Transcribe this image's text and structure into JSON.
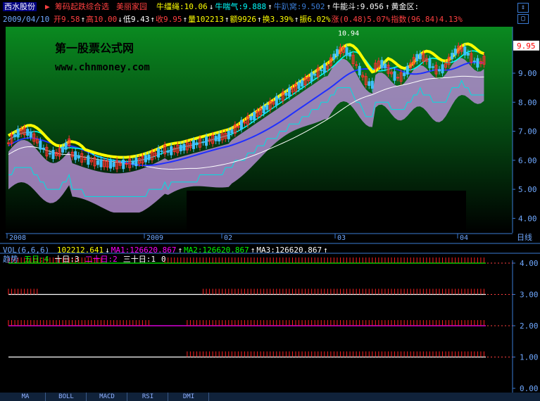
{
  "header": {
    "stock_name": "西水股份",
    "indicator_name": "筹码起跌综合选",
    "theme": "美丽家园",
    "labels": [
      {
        "text": "牛缰绳:10.06",
        "color": "#ffff00",
        "arrow": "↓"
      },
      {
        "text": "牛喘气:9.888",
        "color": "#00ffff",
        "arrow": "↑"
      },
      {
        "text": "牛趴窝:9.502",
        "color": "#3a7bd5",
        "arrow": "↑"
      },
      {
        "text": "牛能斗:9.056",
        "color": "#ffffff",
        "arrow": "↑"
      },
      {
        "text": "黄金区:",
        "color": "#ffffff",
        "arrow": ""
      }
    ],
    "row2": {
      "date": "2009/04/10",
      "open": "开9.58",
      "high": "高10.00",
      "low": "低9.43",
      "close": "收9.95",
      "volume": "量102213",
      "amount": "额9926",
      "turnover": "换3.39%",
      "amplitude": "振6.02%",
      "change": "涨(0.48)5.07%",
      "index": "指数(96.84)4.13%"
    }
  },
  "chart_data": {
    "type": "candlestick",
    "watermark_line1": "第一股票公式网",
    "watermark_line2": "www.chnmoney.com",
    "price_tag": "9.95",
    "peak_label": "10.94",
    "y_ticks": [
      "9.00",
      "8.00",
      "7.00",
      "6.00",
      "5.00",
      "4.00"
    ],
    "x_ticks": [
      "2008",
      "2009",
      "02",
      "03",
      "04"
    ],
    "period_label": "日线",
    "ylim": [
      3.5,
      10.6
    ]
  },
  "volume_bar": {
    "label": "VOL(6,6,6)",
    "value": "102212.641",
    "ma1": "MA1:126620.867",
    "ma2": "MA2:126620.867",
    "ma3": "MA3:126620.867"
  },
  "trend_panel": {
    "title": "趋势",
    "items": [
      {
        "text": "五日:4",
        "color": "#00ff00"
      },
      {
        "text": "十日:3",
        "color": "#ffffff"
      },
      {
        "text": "二十日:2",
        "color": "#ff00ff"
      },
      {
        "text": "三十日:1",
        "color": "#ffffff"
      },
      {
        "text": "0",
        "color": "#ffffff"
      }
    ],
    "y_ticks": [
      "4.00",
      "3.00",
      "2.00",
      "1.00",
      "0.00"
    ]
  },
  "tabs": [
    "MA",
    "BOLL",
    "MACD",
    "RSI",
    "DMI"
  ],
  "icons": {
    "up_down": "⇕",
    "window": "▢"
  }
}
